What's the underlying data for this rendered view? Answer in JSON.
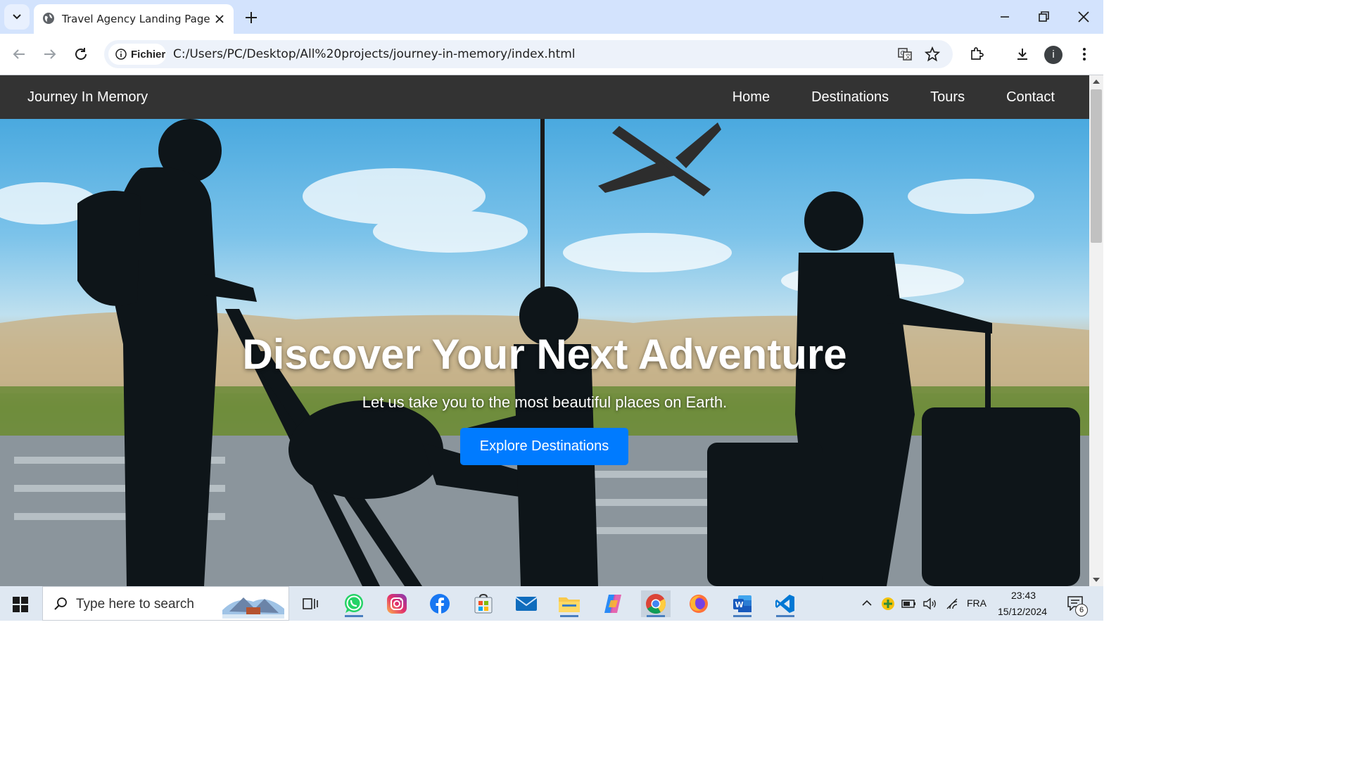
{
  "browser": {
    "tab_title": "Travel Agency Landing Page",
    "chip_label": "Fichier",
    "url": "C:/Users/PC/Desktop/All%20projects/journey-in-memory/index.html",
    "profile_initial": "i"
  },
  "site": {
    "brand": "Journey In Memory",
    "nav": [
      "Home",
      "Destinations",
      "Tours",
      "Contact"
    ],
    "hero": {
      "title": "Discover Your Next Adventure",
      "subtitle": "Let us take you to the most beautiful places on Earth.",
      "cta": "Explore Destinations"
    },
    "colors": {
      "navbar": "#333333",
      "cta": "#007bff"
    }
  },
  "taskbar": {
    "search_placeholder": "Type here to search",
    "apps": [
      "task-view",
      "whatsapp",
      "instagram",
      "facebook",
      "microsoft-store",
      "mail",
      "file-explorer",
      "copilot",
      "chrome",
      "firefox",
      "word",
      "vscode"
    ],
    "language": "FRA",
    "time": "23:43",
    "date": "15/12/2024",
    "notification_count": "6"
  }
}
